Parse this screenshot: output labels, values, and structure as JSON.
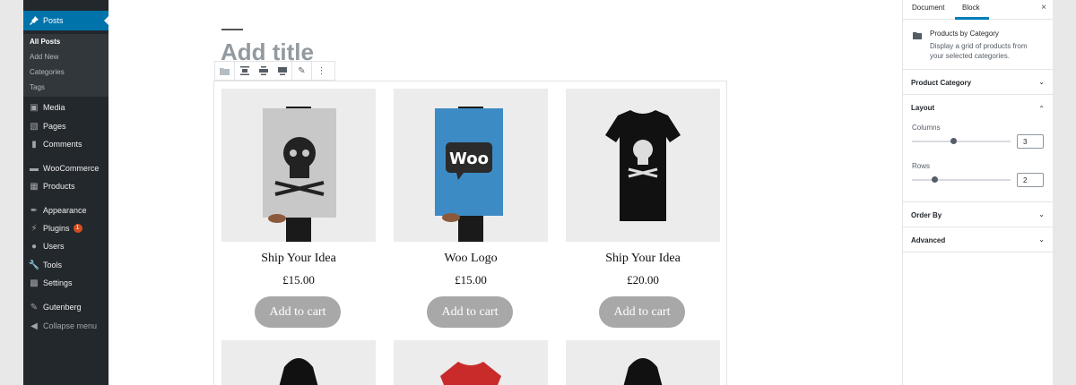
{
  "sidebar": {
    "posts_label": "Posts",
    "submenu": [
      "All Posts",
      "Add New",
      "Categories",
      "Tags"
    ],
    "items": [
      {
        "label": "Media",
        "icon": "media-icon"
      },
      {
        "label": "Pages",
        "icon": "pages-icon"
      },
      {
        "label": "Comments",
        "icon": "comments-icon"
      },
      {
        "label": "WooCommerce",
        "icon": "woocommerce-icon"
      },
      {
        "label": "Products",
        "icon": "products-icon"
      },
      {
        "label": "Appearance",
        "icon": "appearance-icon"
      },
      {
        "label": "Plugins",
        "icon": "plugins-icon",
        "badge": "1"
      },
      {
        "label": "Users",
        "icon": "users-icon"
      },
      {
        "label": "Tools",
        "icon": "tools-icon"
      },
      {
        "label": "Settings",
        "icon": "settings-icon"
      },
      {
        "label": "Gutenberg",
        "icon": "gutenberg-icon"
      },
      {
        "label": "Collapse menu",
        "icon": "collapse-icon"
      }
    ]
  },
  "editor": {
    "title_placeholder": "Add title",
    "products": [
      {
        "name": "Ship Your Idea",
        "price": "£15.00",
        "button": "Add to cart"
      },
      {
        "name": "Woo Logo",
        "price": "£15.00",
        "button": "Add to cart"
      },
      {
        "name": "Ship Your Idea",
        "price": "£20.00",
        "button": "Add to cart"
      }
    ]
  },
  "panel": {
    "tabs": [
      "Document",
      "Block"
    ],
    "active_tab": "Block",
    "block_name": "Products by Category",
    "block_desc_line1": "Display a grid of products from",
    "block_desc_line2": "your selected categories.",
    "sections": {
      "category": "Product Category",
      "layout": "Layout",
      "order": "Order By",
      "advanced": "Advanced"
    },
    "columns_label": "Columns",
    "columns_value": "3",
    "rows_label": "Rows",
    "rows_value": "2",
    "close_glyph": "×"
  },
  "colors": {
    "admin_bg": "#23282d",
    "accent": "#0073aa",
    "button_gray": "#a8a8a8"
  }
}
